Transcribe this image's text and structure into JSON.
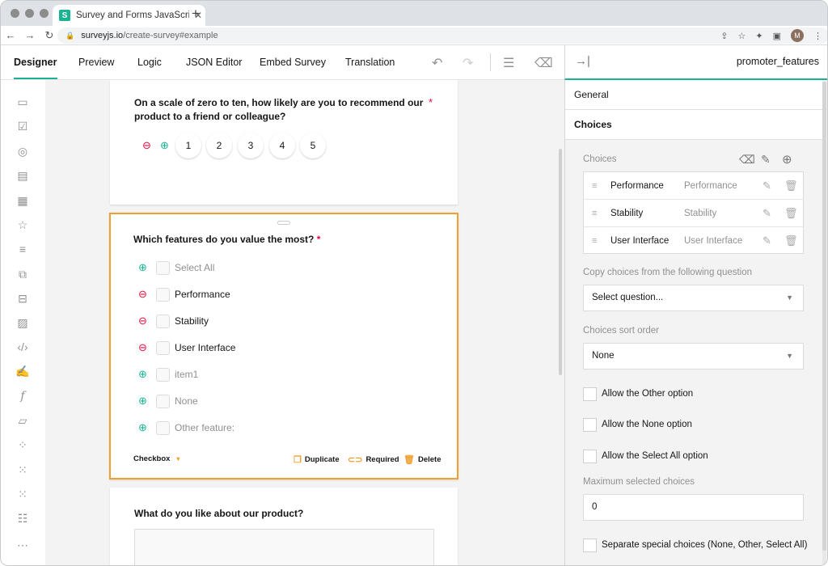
{
  "browser": {
    "tab_title": "Survey and Forms JavaScript L",
    "url_host": "surveyjs.io",
    "url_path": "/create-survey#example",
    "avatar": "M"
  },
  "nav": {
    "tabs": [
      "Designer",
      "Preview",
      "Logic",
      "JSON Editor",
      "Embed Survey",
      "Translation"
    ],
    "active": "Designer"
  },
  "right_header": {
    "element_name": "promoter_features"
  },
  "q1": {
    "title_line1": "On a scale of zero to ten, how likely are you to recommend our",
    "title_line2": "product to a friend or colleague?",
    "required": "*",
    "rates": [
      "1",
      "2",
      "3",
      "4",
      "5"
    ]
  },
  "q2": {
    "title": "Which features do you value the most?",
    "required": "*",
    "choices": [
      {
        "label": "Select All",
        "dim": true,
        "action": "add"
      },
      {
        "label": "Performance",
        "dim": false,
        "action": "remove"
      },
      {
        "label": "Stability",
        "dim": false,
        "action": "remove"
      },
      {
        "label": "User Interface",
        "dim": false,
        "action": "remove"
      },
      {
        "label": "item1",
        "dim": true,
        "action": "add"
      },
      {
        "label": "None",
        "dim": true,
        "action": "add"
      },
      {
        "label": "Other feature:",
        "dim": true,
        "action": "add"
      }
    ],
    "type_label": "Checkbox",
    "duplicate": "Duplicate",
    "required_label": "Required",
    "delete": "Delete"
  },
  "q3": {
    "title": "What do you like about our product?"
  },
  "panel": {
    "section_general": "General",
    "section_choices": "Choices",
    "choices_label": "Choices",
    "choices": [
      {
        "value": "Performance",
        "text": "Performance"
      },
      {
        "value": "Stability",
        "text": "Stability"
      },
      {
        "value": "User Interface",
        "text": "User Interface"
      }
    ],
    "copy_label": "Copy choices from the following question",
    "copy_placeholder": "Select question...",
    "sort_label": "Choices sort order",
    "sort_value": "None",
    "allow_other": "Allow the Other option",
    "allow_none": "Allow the None option",
    "allow_select_all": "Allow the Select All option",
    "max_label": "Maximum selected choices",
    "max_value": "0",
    "separate": "Separate special choices (None, Other, Select All)"
  }
}
